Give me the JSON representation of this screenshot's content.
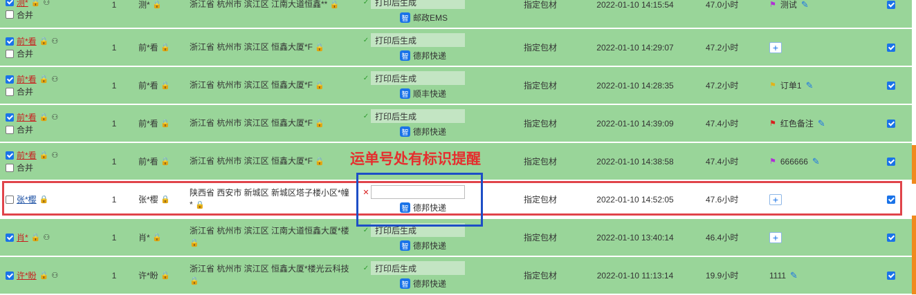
{
  "columns": {
    "merge_label": "合并"
  },
  "annotation": {
    "text": "运单号处有标识提醒"
  },
  "rows": [
    {
      "name": "测*",
      "checked": true,
      "merge": true,
      "qty": "1",
      "receiver": "测*",
      "address": "浙江省 杭州市 滨江区 江南大道恒鑫**",
      "waybill_status": "打印后生成",
      "waybill_error": false,
      "courier": "邮政EMS",
      "packing": "指定包材",
      "time": "2022-01-10 14:15:54",
      "hours": "47.0小时",
      "memo_flag": "purple",
      "memo": "测试",
      "memo_edit": true,
      "selected": true
    },
    {
      "name": "前*看",
      "checked": true,
      "merge": true,
      "qty": "1",
      "receiver": "前*看",
      "address": "浙江省 杭州市 滨江区 恒鑫大厦*F",
      "waybill_status": "打印后生成",
      "waybill_error": false,
      "courier": "德邦快递",
      "packing": "指定包材",
      "time": "2022-01-10 14:29:07",
      "hours": "47.2小时",
      "memo_flag": "",
      "memo": "",
      "memo_edit": false,
      "selected": true
    },
    {
      "name": "前*看",
      "checked": true,
      "merge": true,
      "qty": "1",
      "receiver": "前*看",
      "address": "浙江省 杭州市 滨江区 恒鑫大厦*F",
      "waybill_status": "打印后生成",
      "waybill_error": false,
      "courier": "顺丰快递",
      "packing": "指定包材",
      "time": "2022-01-10 14:28:35",
      "hours": "47.2小时",
      "memo_flag": "yellow",
      "memo": "订单1",
      "memo_edit": true,
      "selected": true
    },
    {
      "name": "前*看",
      "checked": true,
      "merge": true,
      "qty": "1",
      "receiver": "前*看",
      "address": "浙江省 杭州市 滨江区 恒鑫大厦*F",
      "waybill_status": "打印后生成",
      "waybill_error": false,
      "courier": "德邦快递",
      "packing": "指定包材",
      "time": "2022-01-10 14:39:09",
      "hours": "47.4小时",
      "memo_flag": "red",
      "memo": "红色备注",
      "memo_edit": true,
      "selected": true
    },
    {
      "name": "前*看",
      "checked": true,
      "merge": true,
      "qty": "1",
      "receiver": "前*看",
      "address": "浙江省 杭州市 滨江区 恒鑫大厦*F",
      "waybill_status": "",
      "waybill_error": false,
      "courier": "",
      "packing": "指定包材",
      "time": "2022-01-10 14:38:58",
      "hours": "47.4小时",
      "memo_flag": "purple",
      "memo": "666666",
      "memo_edit": true,
      "selected": true
    },
    {
      "name": "张*樱",
      "checked": false,
      "merge": false,
      "qty": "1",
      "receiver": "张*樱",
      "address": "陕西省 西安市 新城区 新城区塔子楼小区*幢*",
      "waybill_status": "",
      "waybill_error": true,
      "courier": "德邦快递",
      "packing": "指定包材",
      "time": "2022-01-10 14:52:05",
      "hours": "47.6小时",
      "memo_flag": "",
      "memo": "",
      "memo_edit": false,
      "selected": true
    },
    {
      "name": "肖*",
      "checked": true,
      "merge": false,
      "qty": "1",
      "receiver": "肖*",
      "address": "浙江省 杭州市 滨江区 江南大道恒鑫大厦*楼",
      "waybill_status": "打印后生成",
      "waybill_error": false,
      "courier": "德邦快递",
      "packing": "指定包材",
      "time": "2022-01-10 13:40:14",
      "hours": "46.4小时",
      "memo_flag": "",
      "memo": "",
      "memo_edit": false,
      "selected": true
    },
    {
      "name": "许*盼",
      "checked": true,
      "merge": false,
      "qty": "1",
      "receiver": "许*盼",
      "address": "浙江省 杭州市 滨江区 恒鑫大厦*楼光云科技",
      "waybill_status": "打印后生成",
      "waybill_error": false,
      "courier": "德邦快递",
      "packing": "指定包材",
      "time": "2022-01-10 11:13:14",
      "hours": "19.9小时",
      "memo_flag": "",
      "memo": "1111",
      "memo_edit": true,
      "selected": true
    }
  ],
  "colors": {
    "row_green": "#99d599",
    "highlight_red": "#e0444a",
    "highlight_blue": "#1d4ec6",
    "accent": "#1a73e8"
  }
}
